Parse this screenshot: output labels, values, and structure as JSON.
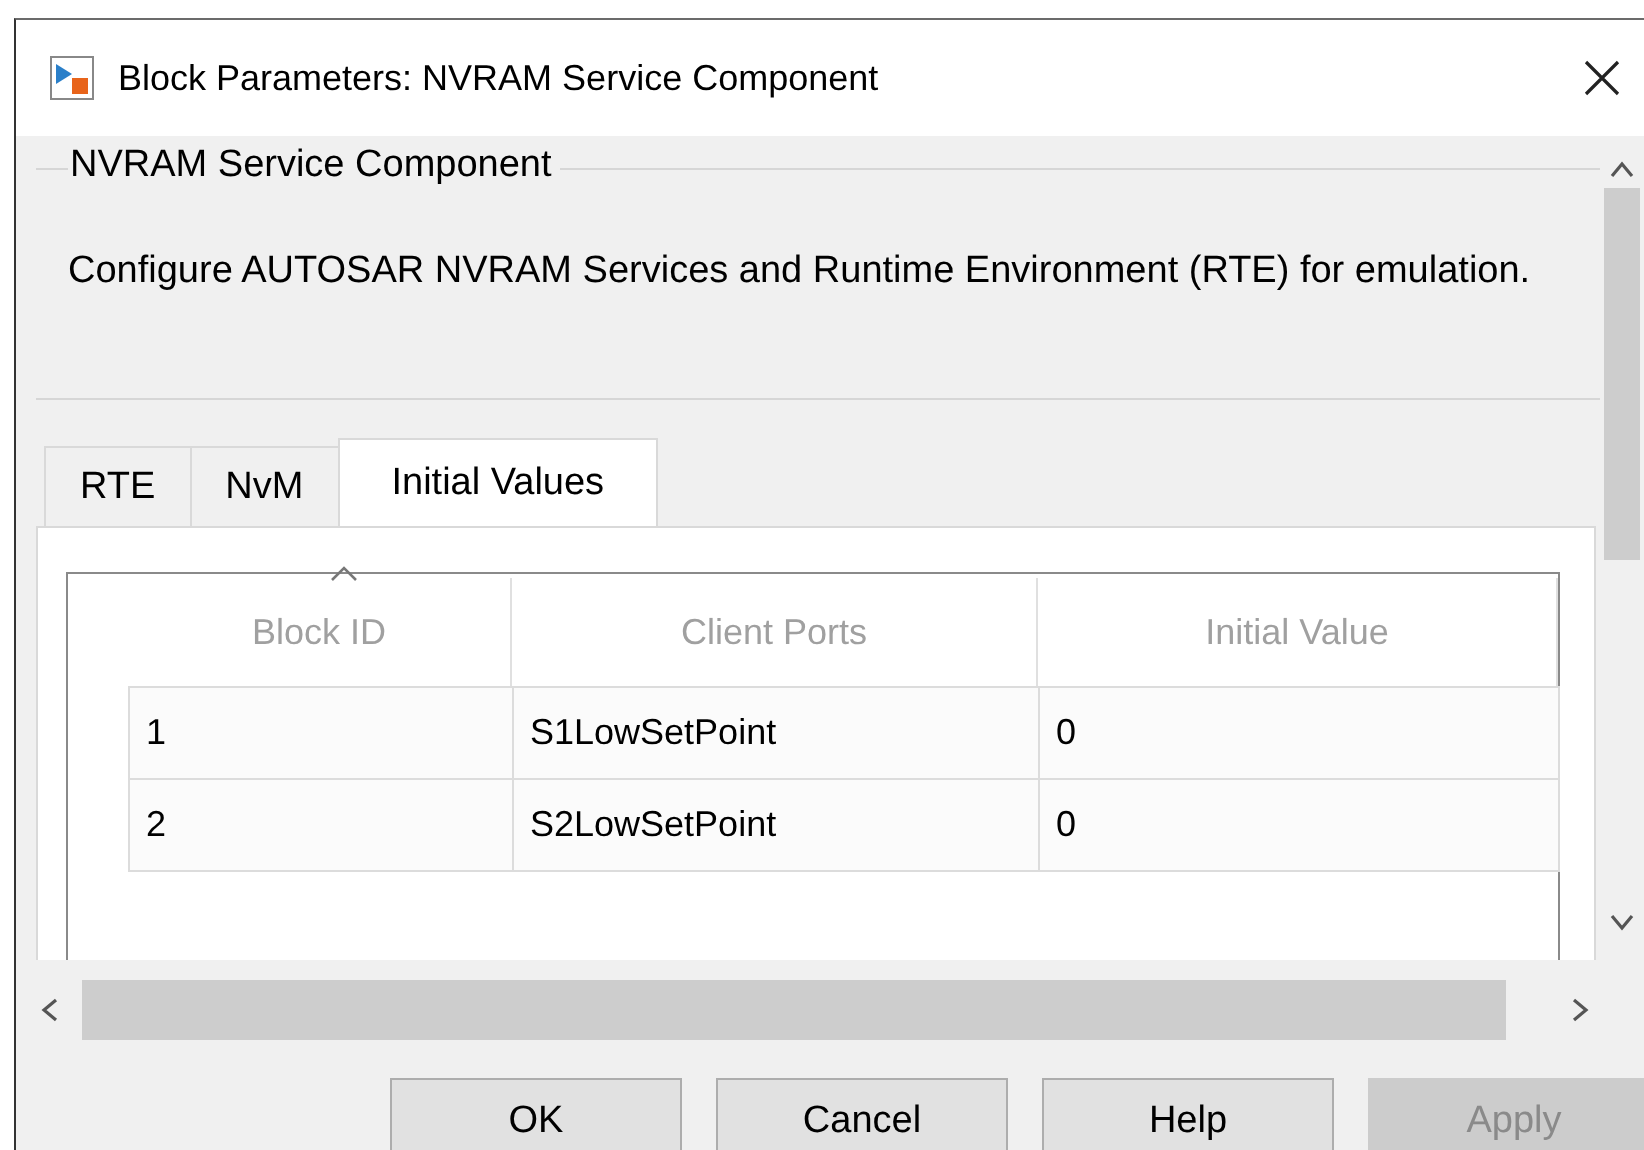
{
  "window": {
    "title": "Block Parameters: NVRAM Service Component"
  },
  "group": {
    "title": "NVRAM Service Component",
    "description": "Configure AUTOSAR NVRAM Services and Runtime Environment (RTE) for emulation."
  },
  "tabs": [
    {
      "label": "RTE",
      "selected": false
    },
    {
      "label": "NvM",
      "selected": false
    },
    {
      "label": "Initial Values",
      "selected": true
    }
  ],
  "table": {
    "columns": [
      "Block ID",
      "Client Ports",
      "Initial Value"
    ],
    "rows": [
      [
        "1",
        "S1LowSetPoint",
        "0"
      ],
      [
        "2",
        "S2LowSetPoint",
        "0"
      ]
    ]
  },
  "buttons": [
    {
      "label": "OK",
      "disabled": false
    },
    {
      "label": "Cancel",
      "disabled": false
    },
    {
      "label": "Help",
      "disabled": false
    },
    {
      "label": "Apply",
      "disabled": true
    }
  ]
}
